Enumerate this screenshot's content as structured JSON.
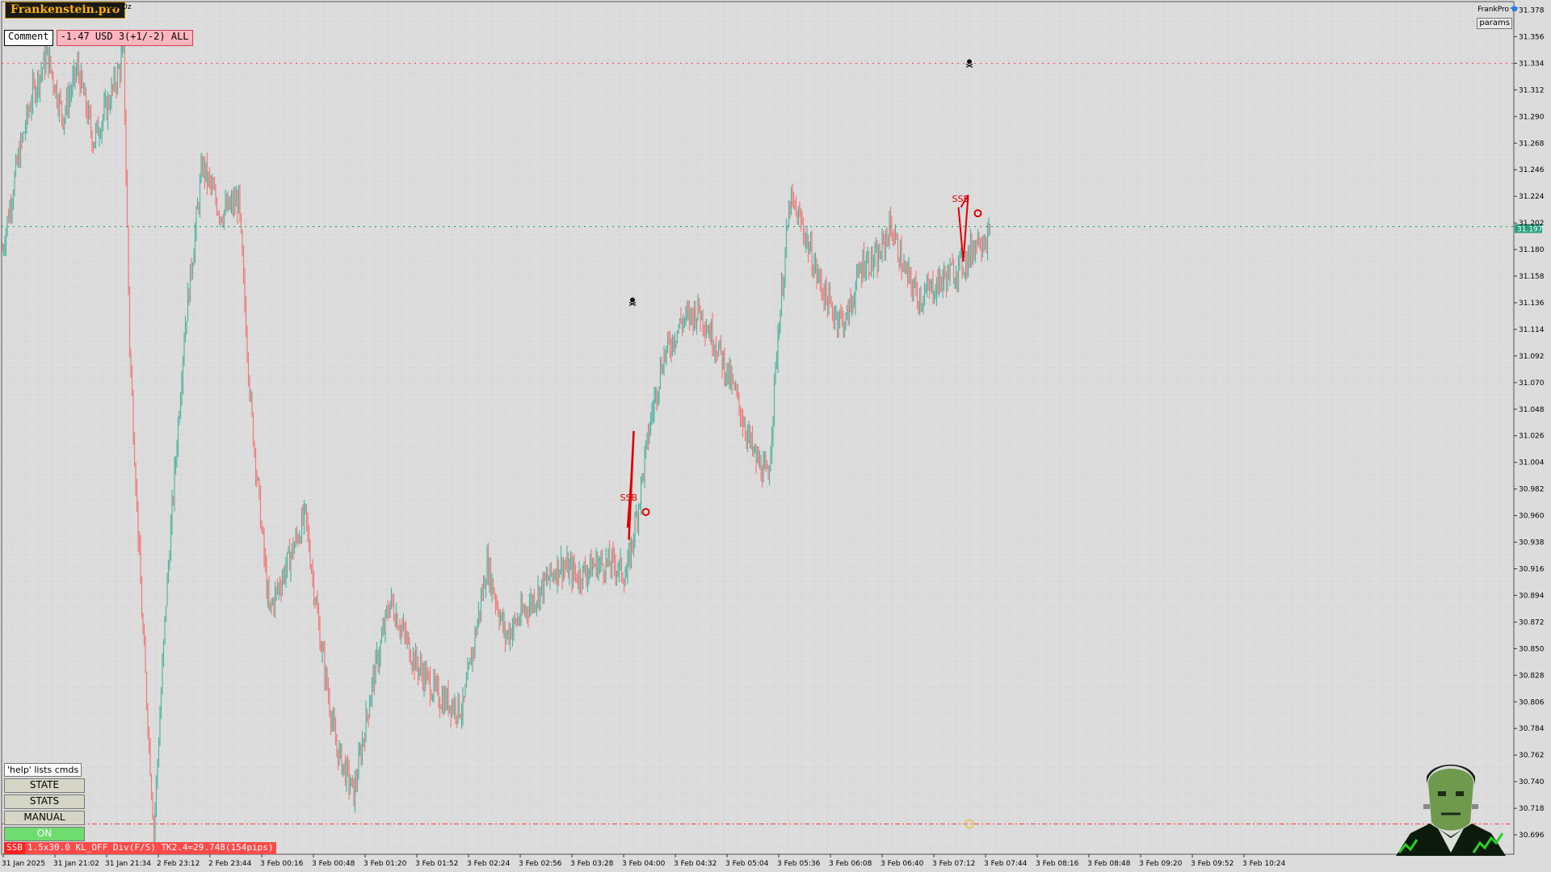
{
  "brand": "Frankenstein.pro",
  "symbol_text": "xoy Oz",
  "comment_label": "Comment",
  "comment_value": "-1.47 USD 3(+1/-2) ALL",
  "top_right": {
    "label": "FrankPro",
    "params_button": "params",
    "icon": "graduation-cap-icon"
  },
  "panel": {
    "help_text": "'help' lists cmds",
    "buttons": [
      {
        "label": "STATE",
        "active": false
      },
      {
        "label": "STATS",
        "active": false
      },
      {
        "label": "MANUAL",
        "active": false
      },
      {
        "label": "ON",
        "active": true
      }
    ]
  },
  "status": {
    "tag": "SSB",
    "text": "1.5x30.0 KL_OFF Div(F/S) TK2.4=29.748(154pips)"
  },
  "colors": {
    "bull": "#52b4a0",
    "bear": "#ef7a7a",
    "background": "#dcdcdc",
    "signal": "#e00000",
    "level_line": "#00a050"
  },
  "chart_data": {
    "type": "candlestick",
    "price_axis": {
      "ticks": [
        "31.378",
        "31.356",
        "31.334",
        "31.312",
        "31.290",
        "31.268",
        "31.246",
        "31.224",
        "31.202",
        "31.180",
        "31.158",
        "31.136",
        "31.114",
        "31.092",
        "31.070",
        "31.048",
        "31.026",
        "31.004",
        "30.982",
        "30.960",
        "30.938",
        "30.916",
        "30.894",
        "30.872",
        "30.850",
        "30.828",
        "30.806",
        "30.784",
        "30.762",
        "30.740",
        "30.718",
        "30.696"
      ],
      "range": [
        30.68,
        31.385
      ]
    },
    "time_axis": {
      "ticks": [
        "31 Jan 2025",
        "31 Jan 21:02",
        "31 Jan 21:34",
        "2 Feb 23:12",
        "2 Feb 23:44",
        "3 Feb 00:16",
        "3 Feb 00:48",
        "3 Feb 01:20",
        "3 Feb 01:52",
        "3 Feb 02:24",
        "3 Feb 02:56",
        "3 Feb 03:28",
        "3 Feb 04:00",
        "3 Feb 04:32",
        "3 Feb 05:04",
        "3 Feb 05:36",
        "3 Feb 06:08",
        "3 Feb 06:40",
        "3 Feb 07:12",
        "3 Feb 07:44",
        "3 Feb 08:16",
        "3 Feb 08:48",
        "3 Feb 09:20",
        "3 Feb 09:52",
        "3 Feb 10:24"
      ]
    },
    "current_price": "31.197",
    "levels": [
      {
        "price": 31.334,
        "style": "dotted",
        "color": "#ff4040"
      },
      {
        "price": 31.199,
        "style": "dotted",
        "color": "#00a050"
      },
      {
        "price": 30.705,
        "style": "dashdot",
        "color": "#ff4040"
      }
    ],
    "path": [
      [
        0,
        31.18
      ],
      [
        12,
        31.25
      ],
      [
        25,
        31.31
      ],
      [
        37,
        31.34
      ],
      [
        50,
        31.29
      ],
      [
        62,
        31.33
      ],
      [
        75,
        31.27
      ],
      [
        87,
        31.3
      ],
      [
        100,
        31.34
      ],
      [
        105,
        31.1
      ],
      [
        115,
        30.88
      ],
      [
        125,
        30.7
      ],
      [
        135,
        30.89
      ],
      [
        150,
        31.11
      ],
      [
        165,
        31.25
      ],
      [
        180,
        31.21
      ],
      [
        195,
        31.22
      ],
      [
        205,
        31.05
      ],
      [
        220,
        30.88
      ],
      [
        235,
        30.92
      ],
      [
        250,
        30.96
      ],
      [
        262,
        30.86
      ],
      [
        275,
        30.77
      ],
      [
        290,
        30.73
      ],
      [
        305,
        30.82
      ],
      [
        320,
        30.89
      ],
      [
        340,
        30.84
      ],
      [
        360,
        30.81
      ],
      [
        380,
        30.8
      ],
      [
        400,
        30.92
      ],
      [
        415,
        30.86
      ],
      [
        430,
        30.88
      ],
      [
        445,
        30.9
      ],
      [
        460,
        30.92
      ],
      [
        475,
        30.91
      ],
      [
        490,
        30.92
      ],
      [
        505,
        30.92
      ],
      [
        515,
        30.91
      ],
      [
        525,
        30.97
      ],
      [
        535,
        31.04
      ],
      [
        545,
        31.09
      ],
      [
        560,
        31.12
      ],
      [
        575,
        31.13
      ],
      [
        590,
        31.1
      ],
      [
        605,
        31.06
      ],
      [
        620,
        31.01
      ],
      [
        632,
        30.99
      ],
      [
        640,
        31.11
      ],
      [
        650,
        31.22
      ],
      [
        660,
        31.2
      ],
      [
        672,
        31.16
      ],
      [
        684,
        31.13
      ],
      [
        696,
        31.12
      ],
      [
        710,
        31.17
      ],
      [
        722,
        31.17
      ],
      [
        733,
        31.2
      ],
      [
        745,
        31.16
      ],
      [
        757,
        31.14
      ],
      [
        770,
        31.15
      ],
      [
        782,
        31.16
      ],
      [
        795,
        31.17
      ],
      [
        805,
        31.19
      ],
      [
        815,
        31.19
      ]
    ],
    "annotations": [
      {
        "text": "SSB",
        "bar": 519,
        "price": 30.975
      },
      {
        "text": "SSB",
        "bar": 793,
        "price": 31.222
      }
    ]
  }
}
